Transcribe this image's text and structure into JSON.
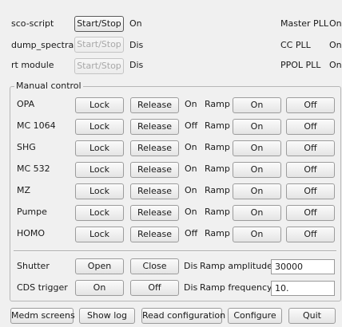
{
  "top": {
    "rows": [
      {
        "label": "sco-script",
        "button": "Start/Stop",
        "status": "On"
      },
      {
        "label": "dump_spectra",
        "button": "Start/Stop",
        "status": "Dis"
      },
      {
        "label": "rt module",
        "button": "Start/Stop",
        "status": "Dis"
      }
    ],
    "plls": [
      {
        "label": "Master PLL",
        "status": "On"
      },
      {
        "label": "CC PLL",
        "status": "On"
      },
      {
        "label": "PPOL PLL",
        "status": "On"
      }
    ]
  },
  "manual": {
    "title": "Manual control",
    "lock_label": "Lock",
    "release_label": "Release",
    "ramp_label": "Ramp",
    "on_label": "On",
    "off_label": "Off",
    "rows": [
      {
        "name": "OPA",
        "status": "On"
      },
      {
        "name": "MC 1064",
        "status": "Off"
      },
      {
        "name": "SHG",
        "status": "On"
      },
      {
        "name": "MC 532",
        "status": "On"
      },
      {
        "name": "MZ",
        "status": "On"
      },
      {
        "name": "Pumpe",
        "status": "On"
      },
      {
        "name": "HOMO",
        "status": "Off"
      }
    ],
    "shutter": {
      "label": "Shutter",
      "btn1": "Open",
      "btn2": "Close",
      "status": "Dis",
      "ramp_label": "Ramp amplitude",
      "value": "30000"
    },
    "cds": {
      "label": "CDS trigger",
      "btn1": "On",
      "btn2": "Off",
      "status": "Dis",
      "ramp_label": "Ramp frequency",
      "value": "10."
    }
  },
  "bottom": {
    "medm": "Medm screens",
    "log": "Show log",
    "readcfg": "Read configuration",
    "configure": "Configure",
    "quit": "Quit"
  }
}
